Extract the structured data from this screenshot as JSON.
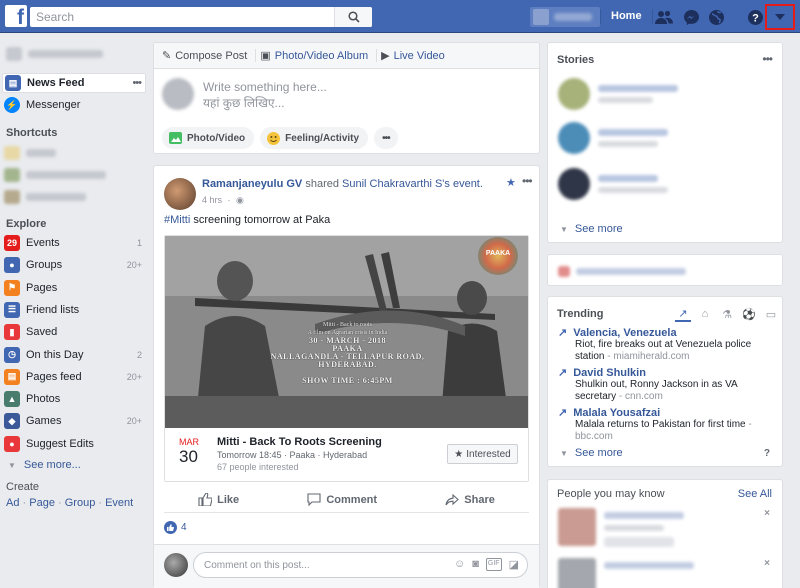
{
  "topbar": {
    "logo_letter": "f",
    "search_placeholder": "Search",
    "home_label": "Home"
  },
  "left_nav": {
    "main": [
      {
        "label": "News Feed",
        "color": "#4267b2"
      },
      {
        "label": "Messenger",
        "color": "#0084ff"
      }
    ],
    "shortcuts_heading": "Shortcuts",
    "explore_heading": "Explore",
    "explore": [
      {
        "label": "Events",
        "count": "1",
        "color": "#e41c1c",
        "glyph": "29"
      },
      {
        "label": "Groups",
        "count": "20+",
        "color": "#4267b2",
        "glyph": "●"
      },
      {
        "label": "Pages",
        "count": "",
        "color": "#f4811f",
        "glyph": "⚑"
      },
      {
        "label": "Friend lists",
        "count": "",
        "color": "#4267b2",
        "glyph": "☰"
      },
      {
        "label": "Saved",
        "count": "",
        "color": "#e9383b",
        "glyph": "▮"
      },
      {
        "label": "On this Day",
        "count": "2",
        "color": "#4267b2",
        "glyph": "◷"
      },
      {
        "label": "Pages feed",
        "count": "20+",
        "color": "#f4811f",
        "glyph": "▤"
      },
      {
        "label": "Photos",
        "count": "",
        "color": "#4a7c6e",
        "glyph": "▲"
      },
      {
        "label": "Games",
        "count": "20+",
        "color": "#3b5998",
        "glyph": "◆"
      },
      {
        "label": "Suggest Edits",
        "count": "",
        "color": "#e9383b",
        "glyph": "●"
      }
    ],
    "see_more": "See more...",
    "create_heading": "Create",
    "create_links": [
      "Ad",
      "Page",
      "Group",
      "Event"
    ]
  },
  "composer": {
    "tabs": [
      "Compose Post",
      "Photo/Video Album",
      "Live Video"
    ],
    "placeholder_line1": "Write something here...",
    "placeholder_line2": "यहां कुछ लिखिए...",
    "actions": [
      "Photo/Video",
      "Feeling/Activity"
    ],
    "more": "•••"
  },
  "post": {
    "author": "Ramanjaneyulu GV",
    "shared_text": "shared",
    "event_owner": "Sunil Chakravarthi S's event.",
    "time": "4 hrs",
    "hashtag": "#Mitti",
    "text_rest": " screening tomorrow at Paka",
    "image_text": {
      "logo": "PAAKA",
      "line1": "Mitti - Back to roots",
      "line2": "A film on Agrarian crisis in India",
      "line3": "30 - MARCH - 2018",
      "line4": "PAAKA",
      "line5": "NALLAGANDLA - TELLAPUR ROAD,",
      "line6": "HYDERABAD.",
      "line7": "SHOW TIME : 6:45PM"
    },
    "event": {
      "month": "MAR",
      "day": "30",
      "title": "Mitti - Back To Roots Screening",
      "detail": "Tomorrow 18:45 · Paaka · Hyderabad",
      "interested_count": "67 people interested",
      "interested_label": "Interested"
    },
    "actions": [
      "Like",
      "Comment",
      "Share"
    ],
    "reaction_count": "4",
    "comment_placeholder": "Comment on this post..."
  },
  "stories": {
    "heading": "Stories",
    "see_more": "See more"
  },
  "trending": {
    "heading": "Trending",
    "items": [
      {
        "title": "Valencia, Venezuela",
        "desc": "Riot, fire breaks out at Venezuela police station",
        "source": "miamiherald.com"
      },
      {
        "title": "David Shulkin",
        "desc": "Shulkin out, Ronny Jackson in as VA secretary",
        "source": "cnn.com"
      },
      {
        "title": "Malala Yousafzai",
        "desc": "Malala returns to Pakistan for first time",
        "source": "bbc.com"
      }
    ],
    "see_more": "See more",
    "help": "?"
  },
  "pymk": {
    "heading": "People you may know",
    "see_all": "See All"
  }
}
